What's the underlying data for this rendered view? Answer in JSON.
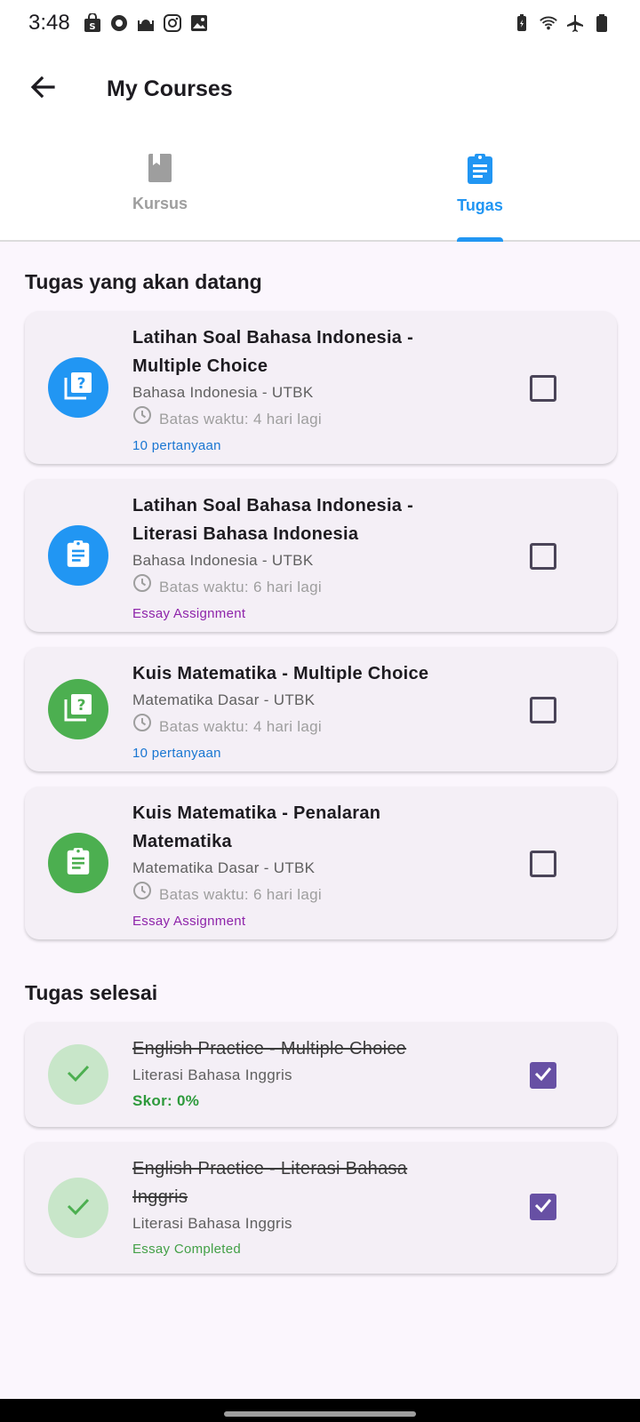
{
  "status_bar": {
    "time": "3:48"
  },
  "app_bar": {
    "title": "My Courses"
  },
  "tabs": [
    {
      "label": "Kursus",
      "active": false
    },
    {
      "label": "Tugas",
      "active": true
    }
  ],
  "upcoming": {
    "heading": "Tugas yang akan datang",
    "items": [
      {
        "title": "Latihan Soal Bahasa Indonesia - Multiple Choice",
        "course": "Bahasa Indonesia - UTBK",
        "deadline": "Batas waktu: 4 hari lagi",
        "meta": "10 pertanyaan",
        "icon": "quiz-icon",
        "color": "#2196f3",
        "checked": false
      },
      {
        "title": "Latihan Soal Bahasa Indonesia - Literasi Bahasa Indonesia",
        "course": "Bahasa Indonesia - UTBK",
        "deadline": "Batas waktu: 6 hari lagi",
        "meta": "Essay Assignment",
        "icon": "assignment-icon",
        "color": "#2196f3",
        "checked": false
      },
      {
        "title": "Kuis Matematika - Multiple Choice",
        "course": "Matematika Dasar - UTBK",
        "deadline": "Batas waktu: 4 hari lagi",
        "meta": "10 pertanyaan",
        "icon": "quiz-icon",
        "color": "#4caf50",
        "checked": false
      },
      {
        "title": "Kuis Matematika - Penalaran Matematika",
        "course": "Matematika Dasar - UTBK",
        "deadline": "Batas waktu: 6 hari lagi",
        "meta": "Essay Assignment",
        "icon": "assignment-icon",
        "color": "#4caf50",
        "checked": false
      }
    ]
  },
  "completed": {
    "heading": "Tugas selesai",
    "items": [
      {
        "title": "English Practice - Multiple Choice",
        "course": "Literasi Bahasa Inggris",
        "meta": "Skor: 0%",
        "icon": "check-icon",
        "checked": true
      },
      {
        "title": "English Practice - Literasi Bahasa Inggris",
        "course": "Literasi Bahasa Inggris",
        "meta": "Essay Completed",
        "icon": "check-icon",
        "checked": true
      }
    ]
  },
  "colors": {
    "accent": "#2196f3",
    "checkbox_checked": "#6750a4",
    "success": "#4caf50",
    "background": "#fbf6fd"
  }
}
